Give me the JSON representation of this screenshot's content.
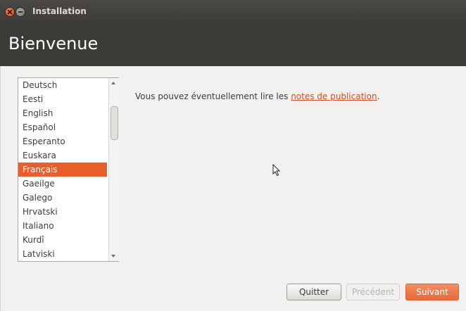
{
  "window": {
    "title": "Installation"
  },
  "header": {
    "title": "Bienvenue"
  },
  "languages": {
    "items": [
      "Deutsch",
      "Eesti",
      "English",
      "Español",
      "Esperanto",
      "Euskara",
      "Français",
      "Gaeilge",
      "Galego",
      "Hrvatski",
      "Italiano",
      "Kurdî",
      "Latviski"
    ],
    "selected": "Français"
  },
  "notes": {
    "text_before": "Vous pouvez éventuellement lire les ",
    "link": "notes de publication",
    "text_after": "."
  },
  "buttons": {
    "quit": "Quitter",
    "previous": "Précédent",
    "next": "Suivant"
  },
  "colors": {
    "accent": "#e95f29",
    "header_bg": "#3c3b37",
    "titlebar_bg": "#3b3a37"
  }
}
